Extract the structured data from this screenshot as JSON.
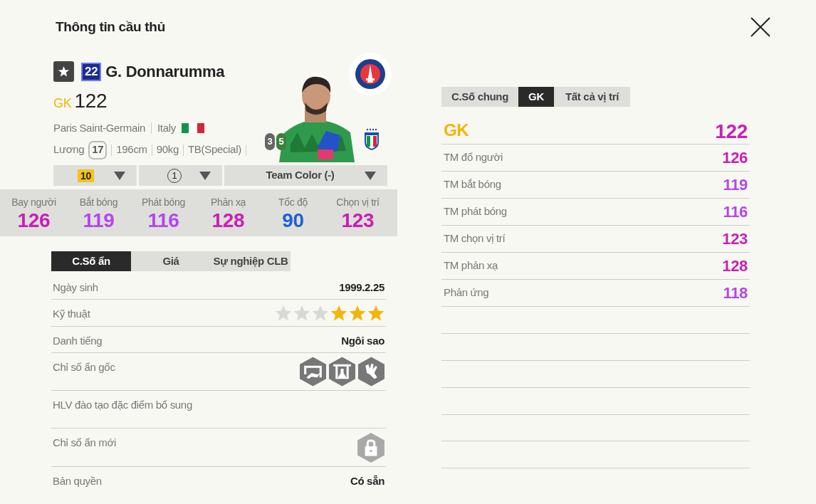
{
  "header": {
    "title": "Thông tin cầu thủ"
  },
  "player": {
    "number": "22",
    "name": "G. Donnarumma",
    "position": "GK",
    "rating": "122",
    "club": "Paris Saint-Germain",
    "nation": "Italy",
    "salary_label": "Lương",
    "salary": "17",
    "height": "196cm",
    "weight": "90kg",
    "body_type": "TB(Special)",
    "weak_foot": "3",
    "strong_foot": "5"
  },
  "selectors": [
    {
      "kind": "level",
      "value": "10"
    },
    {
      "kind": "circled",
      "value": "1"
    },
    {
      "kind": "text",
      "value": "Team Color (-)"
    }
  ],
  "key_stats": [
    {
      "label": "Bay người",
      "value": "126",
      "color": "#c81fb4"
    },
    {
      "label": "Bắt bóng",
      "value": "119",
      "color": "#b246ee"
    },
    {
      "label": "Phát bóng",
      "value": "116",
      "color": "#b246ee"
    },
    {
      "label": "Phản xạ",
      "value": "128",
      "color": "#c81fb4"
    },
    {
      "label": "Tốc độ",
      "value": "90",
      "color": "#1f5fd8"
    },
    {
      "label": "Chọn vị trí",
      "value": "123",
      "color": "#c81fb4"
    }
  ],
  "info_tabs": [
    {
      "label": "C.Số ẩn",
      "selected": true
    },
    {
      "label": "Giá",
      "selected": false
    },
    {
      "label": "Sự nghiệp CLB",
      "selected": false
    }
  ],
  "info_rows": [
    {
      "kind": "text",
      "label": "Ngày sinh",
      "value": "1999.2.25"
    },
    {
      "kind": "stars",
      "label": "Kỹ thuật",
      "stars": 3
    },
    {
      "kind": "text",
      "label": "Danh tiếng",
      "value": "Ngôi sao"
    },
    {
      "kind": "traits",
      "label": "Chỉ số ẩn gốc"
    },
    {
      "kind": "empty",
      "label": "HLV đào tạo đặc điểm bổ sung"
    },
    {
      "kind": "locked",
      "label": "Chỉ số ẩn mới"
    },
    {
      "kind": "text",
      "label": "Bản quyền",
      "value": "Có sẵn"
    }
  ],
  "position_tabs": [
    {
      "label": "C.Số chung",
      "selected": false
    },
    {
      "label": "GK",
      "selected": true
    },
    {
      "label": "Tất cả vị trí",
      "selected": false
    }
  ],
  "position_stats": {
    "position": "GK",
    "rating": "122",
    "color": "#c81fb4",
    "rows": [
      {
        "label": "TM đổ người",
        "value": "126",
        "color": "#c81fb4"
      },
      {
        "label": "TM bắt bóng",
        "value": "119",
        "color": "#b246ee"
      },
      {
        "label": "TM phát bóng",
        "value": "116",
        "color": "#b246ee"
      },
      {
        "label": "TM chọn vị trí",
        "value": "123",
        "color": "#c81fb4"
      },
      {
        "label": "TM phản xạ",
        "value": "128",
        "color": "#c81fb4"
      },
      {
        "label": "Phản ứng",
        "value": "118",
        "color": "#b246ee"
      }
    ]
  }
}
